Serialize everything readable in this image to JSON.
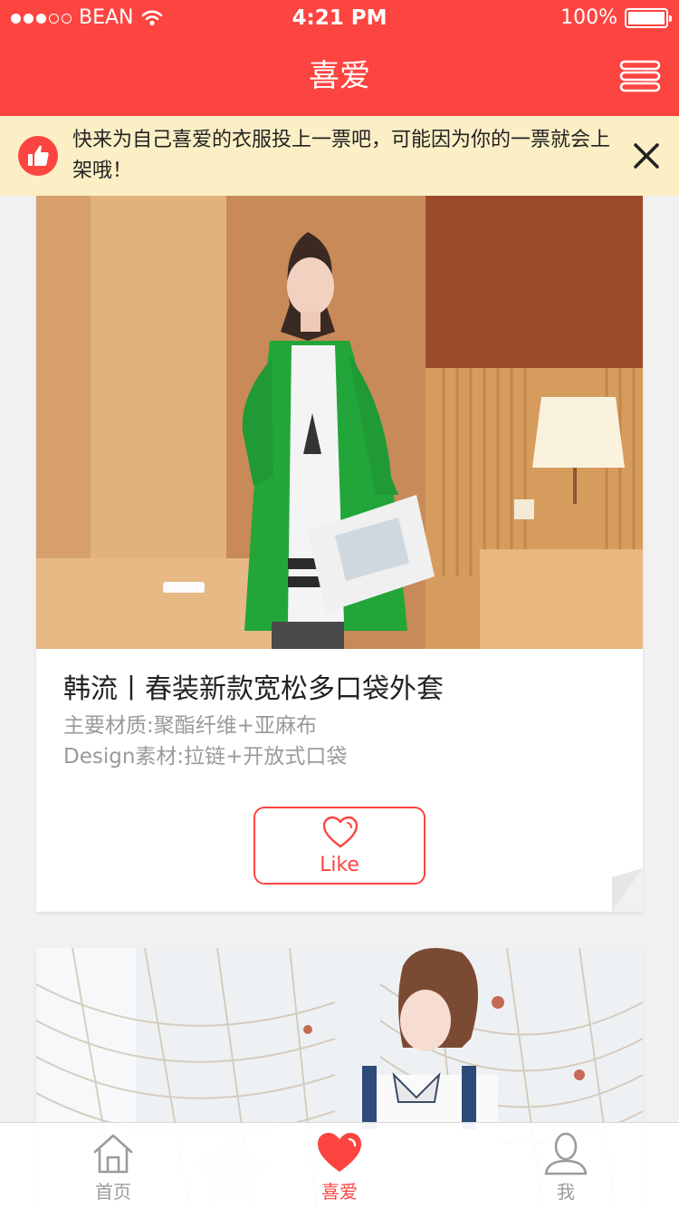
{
  "status": {
    "carrier": "BEAN",
    "time": "4:21 PM",
    "battery": "100%"
  },
  "nav": {
    "title": "喜爱"
  },
  "notice": {
    "text": "快来为自己喜爱的衣服投上一票吧，可能因为你的一票就会上架哦！"
  },
  "cards": [
    {
      "title": "韩流丨春装新款宽松多口袋外套",
      "lines": [
        "主要材质:聚酯纤维+亚麻布",
        "Design素材:拉链+开放式口袋"
      ],
      "like_label": "Like"
    }
  ],
  "tabs": [
    {
      "label": "首页",
      "icon": "home-icon"
    },
    {
      "label": "喜爱",
      "icon": "heart-icon"
    },
    {
      "label": "我",
      "icon": "user-icon"
    }
  ],
  "colors": {
    "accent": "#fc4541",
    "notice_bg": "#fcefc6",
    "page_bg": "#f1f1f1"
  }
}
